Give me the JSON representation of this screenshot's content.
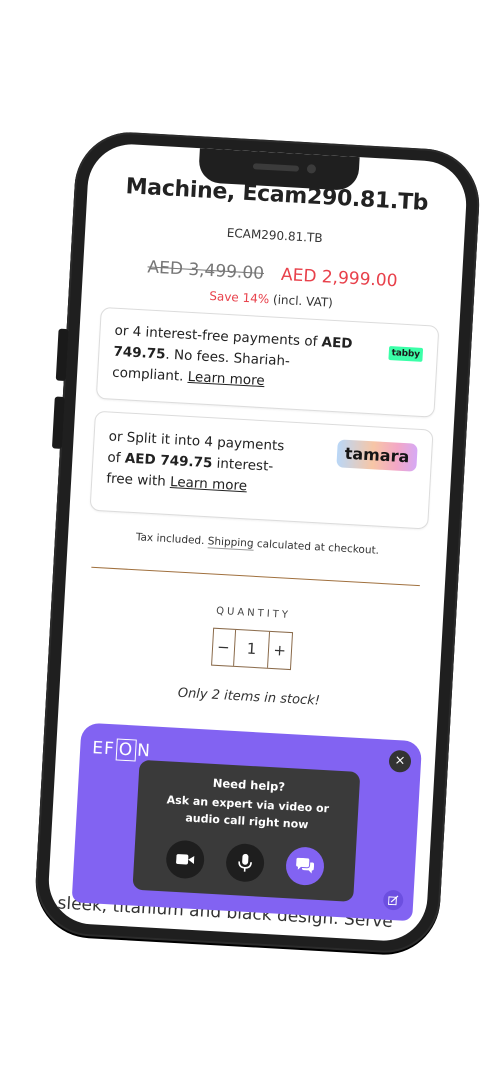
{
  "product": {
    "title": "Machine, Ecam290.81.Tb",
    "sku": "ECAM290.81.TB",
    "old_price": "AED 3,499.00",
    "new_price": "AED 2,999.00",
    "save_pct": "Save 14%",
    "save_suffix": " (incl. VAT)"
  },
  "tabby": {
    "text_a": "or 4 interest-free payments of ",
    "amount": "AED 749.75",
    "text_b": ". No fees. Shariah-compliant. ",
    "link": "Learn more",
    "logo": "tabby"
  },
  "tamara": {
    "text_a": "or Split it into 4 payments of ",
    "amount": "AED 749.75",
    "text_b": " interest-free with ",
    "link": "Learn more",
    "logo": "tamara"
  },
  "tax": {
    "prefix": "Tax included. ",
    "shipping": "Shipping",
    "suffix": " calculated at checkout."
  },
  "quantity": {
    "label": "QUANTITY",
    "minus": "−",
    "value": "1",
    "plus": "+",
    "stock": "Only 2 items in stock!"
  },
  "description_snippet": "sleek, titanium and black design. Serve",
  "widget": {
    "logo_a": "EF",
    "logo_b": "O",
    "logo_c": "N",
    "close": "×",
    "title": "Need help?",
    "subtitle_1": "Ask an expert via video or",
    "subtitle_2": "audio call right now",
    "buttons": [
      "video-camera-icon",
      "microphone-icon",
      "chat-icon"
    ],
    "accent_color": "#8263f2"
  }
}
